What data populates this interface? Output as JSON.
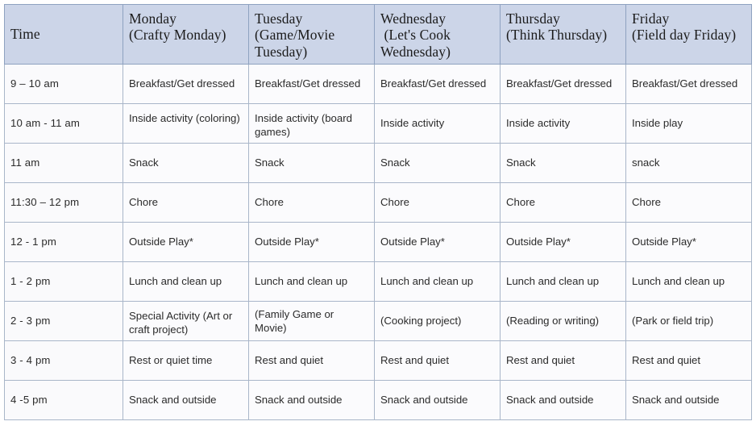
{
  "table": {
    "headers": [
      {
        "name": "time",
        "lines": [
          "Time"
        ]
      },
      {
        "name": "monday",
        "lines": [
          "Monday",
          "(Crafty Monday)"
        ]
      },
      {
        "name": "tuesday",
        "lines": [
          "Tuesday",
          "(Game/Movie",
          "Tuesday)"
        ]
      },
      {
        "name": "wednesday",
        "lines": [
          "Wednesday",
          " (Let's Cook",
          "Wednesday)"
        ]
      },
      {
        "name": "thursday",
        "lines": [
          "Thursday",
          "(Think Thursday)"
        ]
      },
      {
        "name": "friday",
        "lines": [
          "Friday",
          "(Field day Friday)"
        ]
      }
    ],
    "rows": [
      {
        "time": "9 – 10 am",
        "monday": "Breakfast/Get dressed",
        "tuesday": "Breakfast/Get dressed",
        "wednesday": "Breakfast/Get dressed",
        "thursday": "Breakfast/Get dressed",
        "friday": "Breakfast/Get dressed"
      },
      {
        "time": "10 am  - 11 am",
        "monday": "Inside activity (coloring)",
        "tuesday": "Inside activity (board games)",
        "wednesday": "Inside activity",
        "thursday": "Inside activity",
        "friday": "Inside play"
      },
      {
        "time": "11 am",
        "monday": "Snack",
        "tuesday": "Snack",
        "wednesday": "Snack",
        "thursday": "Snack",
        "friday": "snack"
      },
      {
        "time": "11:30 – 12 pm",
        "monday": "Chore",
        "tuesday": "Chore",
        "wednesday": "Chore",
        "thursday": "Chore",
        "friday": "Chore"
      },
      {
        "time": "12 - 1 pm",
        "monday": "Outside Play*",
        "tuesday": "Outside Play*",
        "wednesday": "Outside Play*",
        "thursday": "Outside Play*",
        "friday": "Outside Play*"
      },
      {
        "time": "1 - 2 pm",
        "monday": "Lunch and clean up",
        "tuesday": "Lunch and clean up",
        "wednesday": "Lunch and clean up",
        "thursday": "Lunch and clean up",
        "friday": "Lunch and clean up"
      },
      {
        "time": "2 - 3 pm",
        "monday": "Special Activity (Art or craft project)",
        "tuesday": "(Family Game or Movie)",
        "wednesday": "(Cooking project)",
        "thursday": "(Reading or writing)",
        "friday": "(Park or field trip)"
      },
      {
        "time": "3 - 4 pm",
        "monday": "Rest or quiet time",
        "tuesday": "Rest and quiet",
        "wednesday": "Rest and quiet",
        "thursday": "Rest and quiet",
        "friday": "Rest and quiet"
      },
      {
        "time": "4 -5 pm",
        "monday": "Snack and outside",
        "tuesday": "Snack and outside",
        "wednesday": "Snack and outside",
        "thursday": "Snack and outside",
        "friday": "Snack and outside"
      }
    ]
  },
  "style": {
    "header_background": "#ccd5e8",
    "cell_background": "#fbfbfd",
    "border_color": "#a9b6c9",
    "outer_border_color": "#8794a8",
    "text_color": "#2b2b2b"
  }
}
